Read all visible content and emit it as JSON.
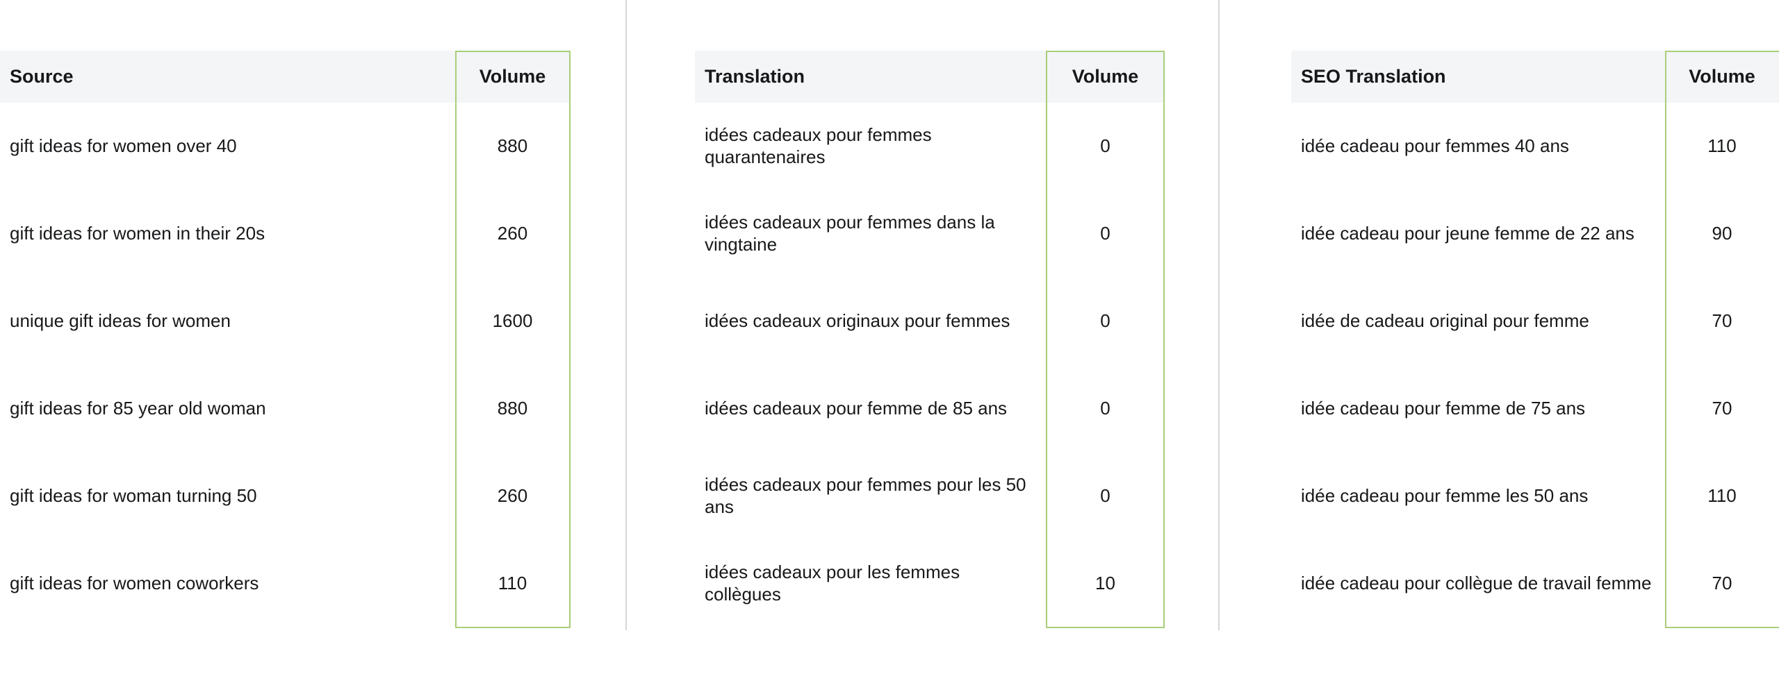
{
  "theme": {
    "highlight_border_color": "#a9ce78",
    "header_background": "#f4f5f7",
    "divider_color": "#d5d7da",
    "text_color": "#17181a",
    "page_background": "#ffffff"
  },
  "panels": [
    {
      "id": "source",
      "headers": {
        "term": "Source",
        "volume": "Volume"
      },
      "rows": [
        {
          "term": "gift ideas for women over 40",
          "volume": "880"
        },
        {
          "term": "gift ideas for women in their 20s",
          "volume": "260"
        },
        {
          "term": "unique gift ideas for women",
          "volume": "1600"
        },
        {
          "term": "gift ideas for 85 year old woman",
          "volume": "880"
        },
        {
          "term": "gift ideas for woman turning 50",
          "volume": "260"
        },
        {
          "term": "gift ideas for women coworkers",
          "volume": "110"
        }
      ]
    },
    {
      "id": "translation",
      "headers": {
        "term": "Translation",
        "volume": "Volume"
      },
      "rows": [
        {
          "term": "idées cadeaux pour femmes quarantenaires",
          "volume": "0"
        },
        {
          "term": "idées cadeaux pour femmes dans la vingtaine",
          "volume": "0"
        },
        {
          "term": "idées cadeaux originaux pour femmes",
          "volume": "0"
        },
        {
          "term": "idées cadeaux pour femme de 85 ans",
          "volume": "0"
        },
        {
          "term": "idées cadeaux pour femmes pour les 50 ans",
          "volume": "0"
        },
        {
          "term": "idées cadeaux pour les femmes collègues",
          "volume": "10"
        }
      ]
    },
    {
      "id": "seo-translation",
      "headers": {
        "term": "SEO Translation",
        "volume": "Volume"
      },
      "rows": [
        {
          "term": "idée cadeau pour femmes 40 ans",
          "volume": "110"
        },
        {
          "term": "idée cadeau pour jeune femme de 22 ans",
          "volume": "90"
        },
        {
          "term": "idée de cadeau original pour femme",
          "volume": "70"
        },
        {
          "term": "idée cadeau pour femme de 75 ans",
          "volume": "70"
        },
        {
          "term": "idée cadeau pour femme les 50 ans",
          "volume": "110"
        },
        {
          "term": "idée cadeau pour collègue de travail femme",
          "volume": "70"
        }
      ]
    }
  ]
}
